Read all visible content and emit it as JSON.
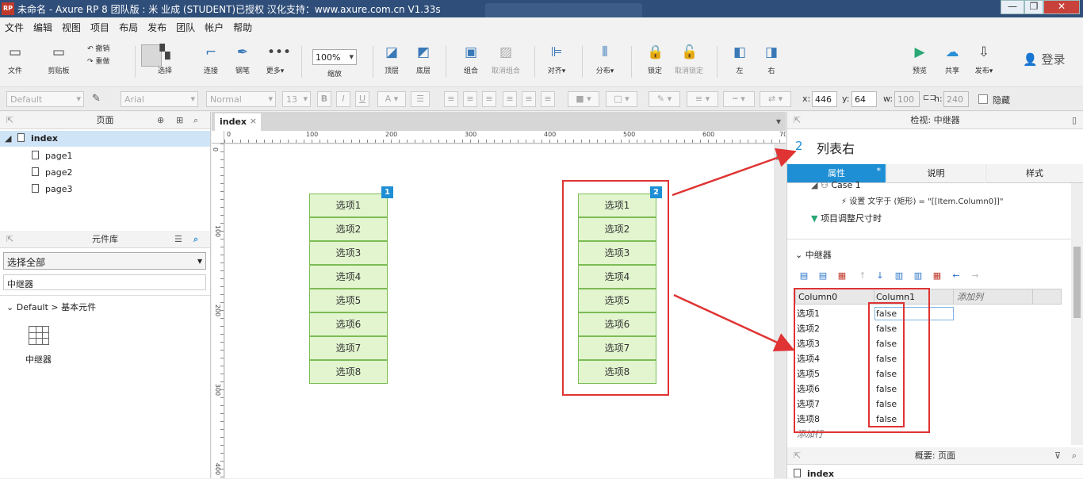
{
  "window": {
    "logo": "RP",
    "title": "未命名 - Axure RP 8 团队版 : 米 业成 (STUDENT)已授权 汉化支持：www.axure.com.cn V1.33s",
    "controls": [
      "—",
      "❐",
      "✕"
    ]
  },
  "menu": [
    "文件",
    "编辑",
    "视图",
    "项目",
    "布局",
    "发布",
    "团队",
    "帐户",
    "帮助"
  ],
  "toolbar": {
    "file": "文件",
    "clipboard": "剪贴板",
    "undo": "撤销",
    "redo": "重做",
    "select": "选择",
    "connect": "连接",
    "pen": "钢笔",
    "more": "更多▾",
    "zoom_value": "100%",
    "zoom": "缩放",
    "top": "顶层",
    "bottom": "底层",
    "group": "组合",
    "ungroup": "取消组合",
    "align": "对齐▾",
    "distribute": "分布▾",
    "lock": "锁定",
    "unlock": "取消锁定",
    "left": "左",
    "right": "右",
    "preview": "预览",
    "share": "共享",
    "publish": "发布▾",
    "login": "登录"
  },
  "format": {
    "style": "Default",
    "font": "Arial",
    "weight": "Normal",
    "size": "13",
    "x_label": "x:",
    "x": "446",
    "y_label": "y:",
    "y": "64",
    "w_label": "w:",
    "w": "100",
    "h_label": "h:",
    "h": "240",
    "hidden": "隐藏"
  },
  "pages_panel": {
    "title": "页面",
    "root": "index",
    "children": [
      "page1",
      "page2",
      "page3"
    ]
  },
  "library_panel": {
    "title": "元件库",
    "filter": "选择全部",
    "search": "中继器",
    "group": "Default > 基本元件",
    "widget": "中继器"
  },
  "canvas": {
    "tab": "index",
    "ruler_h": [
      "0",
      "100",
      "200",
      "300",
      "400",
      "500",
      "600",
      "70"
    ],
    "ruler_v": [
      "0",
      "100",
      "200",
      "300",
      "400"
    ],
    "repeater1": {
      "badge": "1",
      "items": [
        "选项1",
        "选项2",
        "选项3",
        "选项4",
        "选项5",
        "选项6",
        "选项7",
        "选项8"
      ]
    },
    "repeater2": {
      "badge": "2",
      "items": [
        "选项1",
        "选项2",
        "选项3",
        "选项4",
        "选项5",
        "选项6",
        "选项7",
        "选项8"
      ]
    }
  },
  "inspector": {
    "header": "检视: 中继器",
    "widget_number": "2",
    "widget_name": "列表右",
    "tabs": [
      "属性",
      "说明",
      "样式"
    ],
    "tab_marker": "*",
    "case": "Case 1",
    "action": "设置 文字于 (矩形) = \"[[Item.Column0]]\"",
    "event2": "项目调整尺寸时",
    "section": "中继器",
    "columns": [
      "Column0",
      "Column1",
      "添加列"
    ],
    "rows": [
      [
        "选项1",
        "false"
      ],
      [
        "选项2",
        "false"
      ],
      [
        "选项3",
        "false"
      ],
      [
        "选项4",
        "false"
      ],
      [
        "选项5",
        "false"
      ],
      [
        "选项6",
        "false"
      ],
      [
        "选项7",
        "false"
      ],
      [
        "选项8",
        "false"
      ]
    ],
    "add_row": "添加行",
    "outline_header": "概要: 页面",
    "outline_root": "index"
  }
}
